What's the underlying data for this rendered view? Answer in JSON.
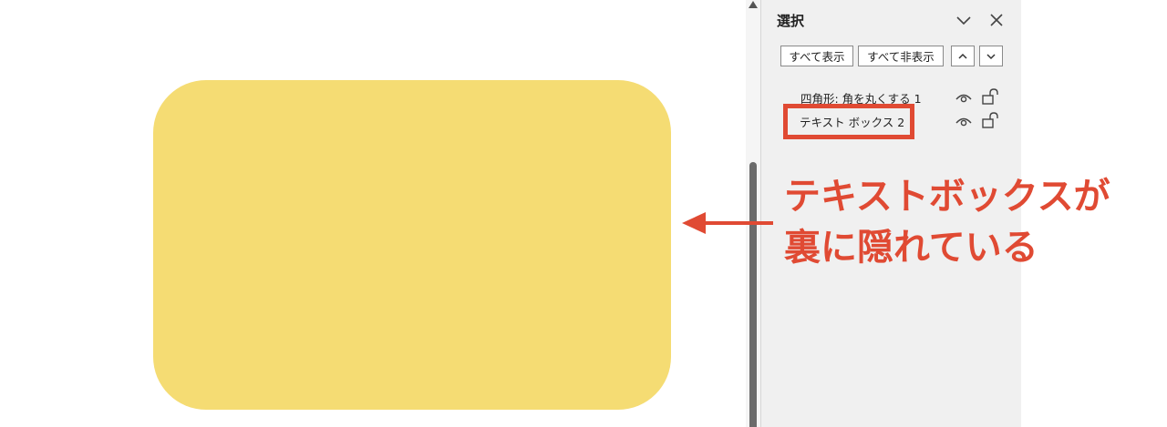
{
  "canvas": {
    "shape_color": "#f5dc73"
  },
  "selection_pane": {
    "title": "選択",
    "show_all_label": "すべて表示",
    "hide_all_label": "すべて非表示",
    "items": [
      {
        "label": "四角形: 角を丸くする 1"
      },
      {
        "label": "テキスト ボックス 2"
      }
    ]
  },
  "annotation": {
    "line1": "テキストボックスが",
    "line2": "裏に隠れている",
    "color": "#e04a33"
  }
}
